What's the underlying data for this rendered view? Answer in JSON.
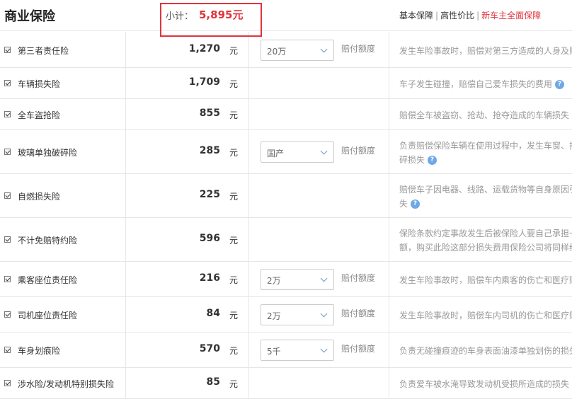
{
  "header": {
    "title": "商业保险",
    "subtotal_label": "小计：",
    "subtotal_value": "5,895元",
    "plans": [
      "基本保障",
      "高性价比",
      "新车主全面保障"
    ],
    "separator": "|"
  },
  "unit": "元",
  "limit_label": "赔付额度",
  "rows": [
    {
      "name": "第三者责任险",
      "price": "1,270",
      "option": "20万",
      "desc": [
        "发生车险事故时，赔偿对第三方造成的人身及财产损失"
      ]
    },
    {
      "name": "车辆损失险",
      "price": "1,709",
      "option": "",
      "desc": [
        "车子发生碰撞，赔偿自己爱车损失的费用"
      ]
    },
    {
      "name": "全车盗抢险",
      "price": "855",
      "option": "",
      "desc": [
        "赔偿全车被盗窃、抢劫、抢夺造成的车辆损失"
      ]
    },
    {
      "name": "玻璃单独破碎险",
      "price": "285",
      "option": "国产",
      "desc": [
        "负责赔偿保险车辆在使用过程中，发生车窗、挡风玻璃单独破",
        "碎损失"
      ]
    },
    {
      "name": "自燃损失险",
      "price": "225",
      "option": "",
      "desc": [
        "赔偿车子因电器、线路、运载货物等自身原因引起火灾造成的损",
        "失"
      ]
    },
    {
      "name": "不计免赔特约险",
      "price": "596",
      "option": "",
      "desc": [
        "保险条款约定事故发生后被保险人要自己承担一定比例的损失金",
        "额，购买此险这部分损失费用保险公司将同样给予赔偿"
      ]
    },
    {
      "name": "乘客座位责任险",
      "price": "216",
      "option": "2万",
      "desc": [
        "发生车险事故时，赔偿车内乘客的伤亡和医疗赔偿费用"
      ]
    },
    {
      "name": "司机座位责任险",
      "price": "84",
      "option": "2万",
      "desc": [
        "发生车险事故时，赔偿车内司机的伤亡和医疗赔偿费用"
      ]
    },
    {
      "name": "车身划痕险",
      "price": "570",
      "option": "5千",
      "desc": [
        "负责无碰撞痕迹的车身表面油漆单独划伤的损失"
      ]
    },
    {
      "name": "涉水险/发动机特别损失险",
      "price": "85",
      "option": "",
      "desc": [
        "负责爱车被水淹导致发动机受损所造成的损失"
      ]
    }
  ]
}
